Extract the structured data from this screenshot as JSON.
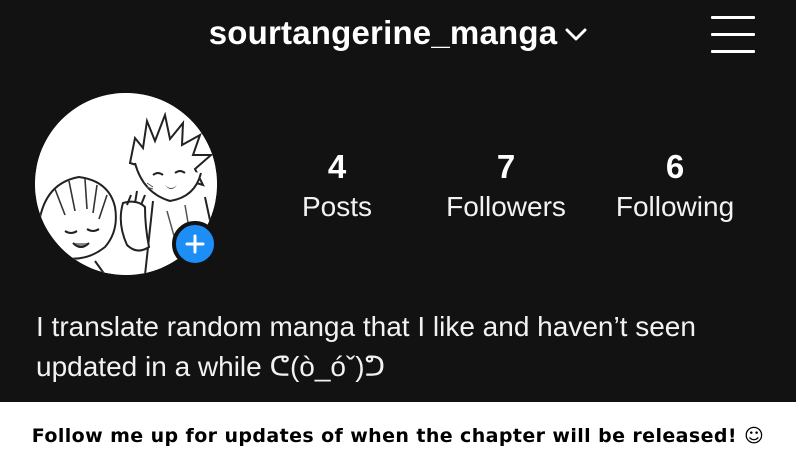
{
  "header": {
    "username": "sourtangerine_manga",
    "username_dropdown_icon": "chevron-down-icon",
    "menu_icon": "hamburger-menu-icon"
  },
  "profile": {
    "avatar_icon": "manga-avatar",
    "add_story_icon": "plus-icon",
    "accent_color": "#1e8ef7",
    "stats": [
      {
        "value": "4",
        "label": "Posts"
      },
      {
        "value": "7",
        "label": "Followers"
      },
      {
        "value": "6",
        "label": "Following"
      }
    ],
    "bio_line1": "I translate random manga that I like and haven’t seen",
    "bio_line2": "updated in a while ᕦ(ò_óˇ)ᕤ"
  },
  "caption": "Follow me up for updates of when the chapter will be released! ☺"
}
